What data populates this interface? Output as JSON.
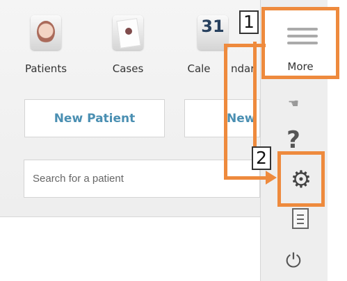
{
  "top_nav": {
    "items": [
      {
        "label": "Patients",
        "icon": "patient-avatar-icon"
      },
      {
        "label": "Cases",
        "icon": "case-avatar-icon"
      },
      {
        "label_visible_part": "Cale",
        "label_remaining": "ndar",
        "icon_text": "31",
        "icon": "calendar-icon"
      }
    ]
  },
  "actions": {
    "new_patient": "New Patient",
    "new_case_visible": "New C"
  },
  "search": {
    "placeholder": "Search for a patient",
    "value": ""
  },
  "menu": {
    "more_label": "More",
    "help_symbol": "?",
    "settings_symbol": "⚙",
    "power_symbol": "⏻"
  },
  "annotations": {
    "step_1": "1",
    "step_2": "2"
  },
  "colors": {
    "highlight": "#ee8a3d",
    "button_text": "#4a8fb2",
    "menu_background": "#eeeeee"
  }
}
